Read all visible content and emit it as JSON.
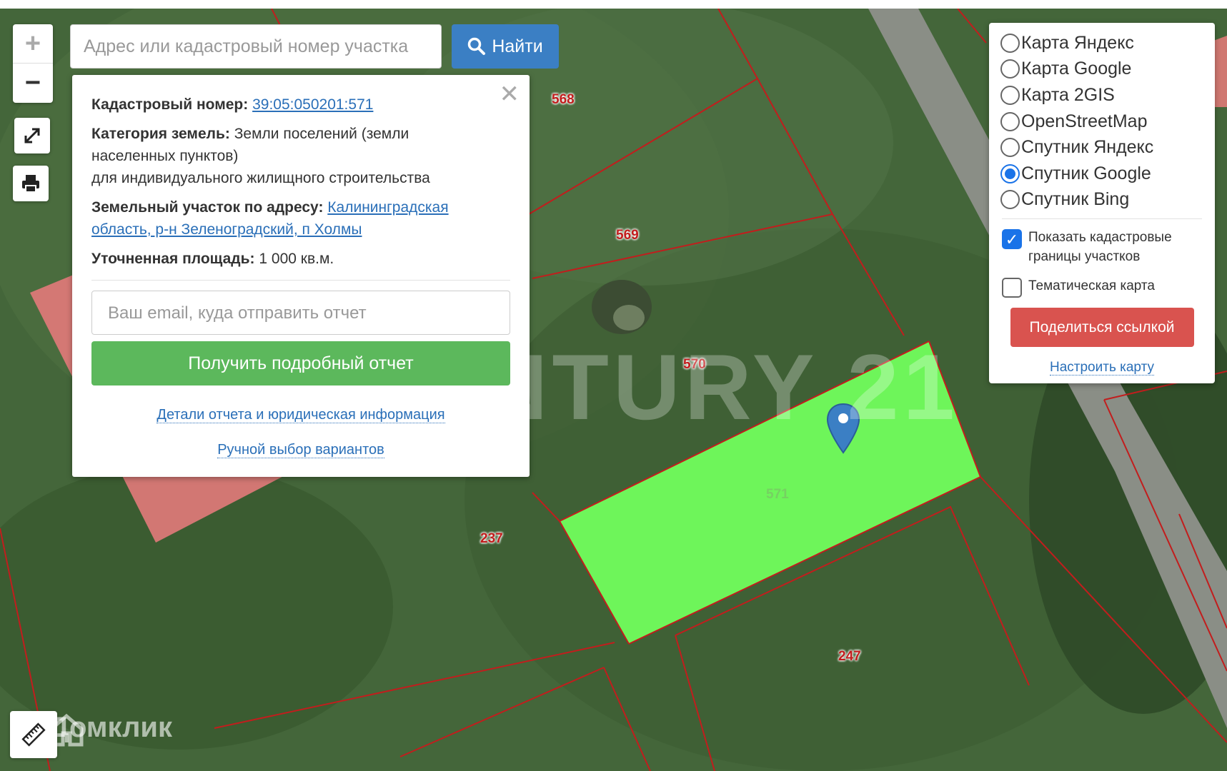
{
  "search": {
    "placeholder": "Адрес или кадастровый номер участка",
    "button_label": "Найти"
  },
  "popup": {
    "cadastral_label": "Кадастровый номер:",
    "cadastral_number": "39:05:050201:571",
    "category_label": "Категория земель:",
    "category_value": "Земли поселений (земли населенных пунктов)",
    "usage": "для индивидуального жилищного строительства",
    "address_label": "Земельный участок по адресу:",
    "address_value": "Калининградская область, р-н Зеленоградский, п Холмы",
    "area_label": "Уточненная площадь:",
    "area_value": "1 000 кв.м.",
    "email_placeholder": "Ваш email, куда отправить отчет",
    "report_button": "Получить подробный отчет",
    "details_link": "Детали отчета и юридическая информация",
    "manual_link": "Ручной выбор вариантов"
  },
  "layers": {
    "options": [
      {
        "label": "Карта Яндекс",
        "selected": false
      },
      {
        "label": "Карта Google",
        "selected": false
      },
      {
        "label": "Карта 2GIS",
        "selected": false
      },
      {
        "label": "OpenStreetMap",
        "selected": false
      },
      {
        "label": "Спутник Яндекс",
        "selected": false
      },
      {
        "label": "Спутник Google",
        "selected": true
      },
      {
        "label": "Спутник Bing",
        "selected": false
      }
    ],
    "show_borders_label": "Показать кадастровые границы участков",
    "show_borders_checked": true,
    "thematic_label": "Тематическая карта",
    "thematic_checked": false,
    "share_button": "Поделиться ссылкой",
    "configure_link": "Настроить карту"
  },
  "parcel_labels": [
    "568",
    "569",
    "570",
    "237",
    "247",
    "571"
  ],
  "watermarks": {
    "main": "CENTURY 21",
    "site": "Домклик"
  },
  "colors": {
    "selected_parcel": "#6ef55a",
    "boundary": "#c21d1d",
    "accent": "#3b7fc4"
  },
  "icons": {
    "zoom_in": "plus-icon",
    "zoom_out": "minus-icon",
    "fullscreen": "expand-icon",
    "print": "printer-icon",
    "ruler": "ruler-icon",
    "marker": "map-pin-icon"
  }
}
